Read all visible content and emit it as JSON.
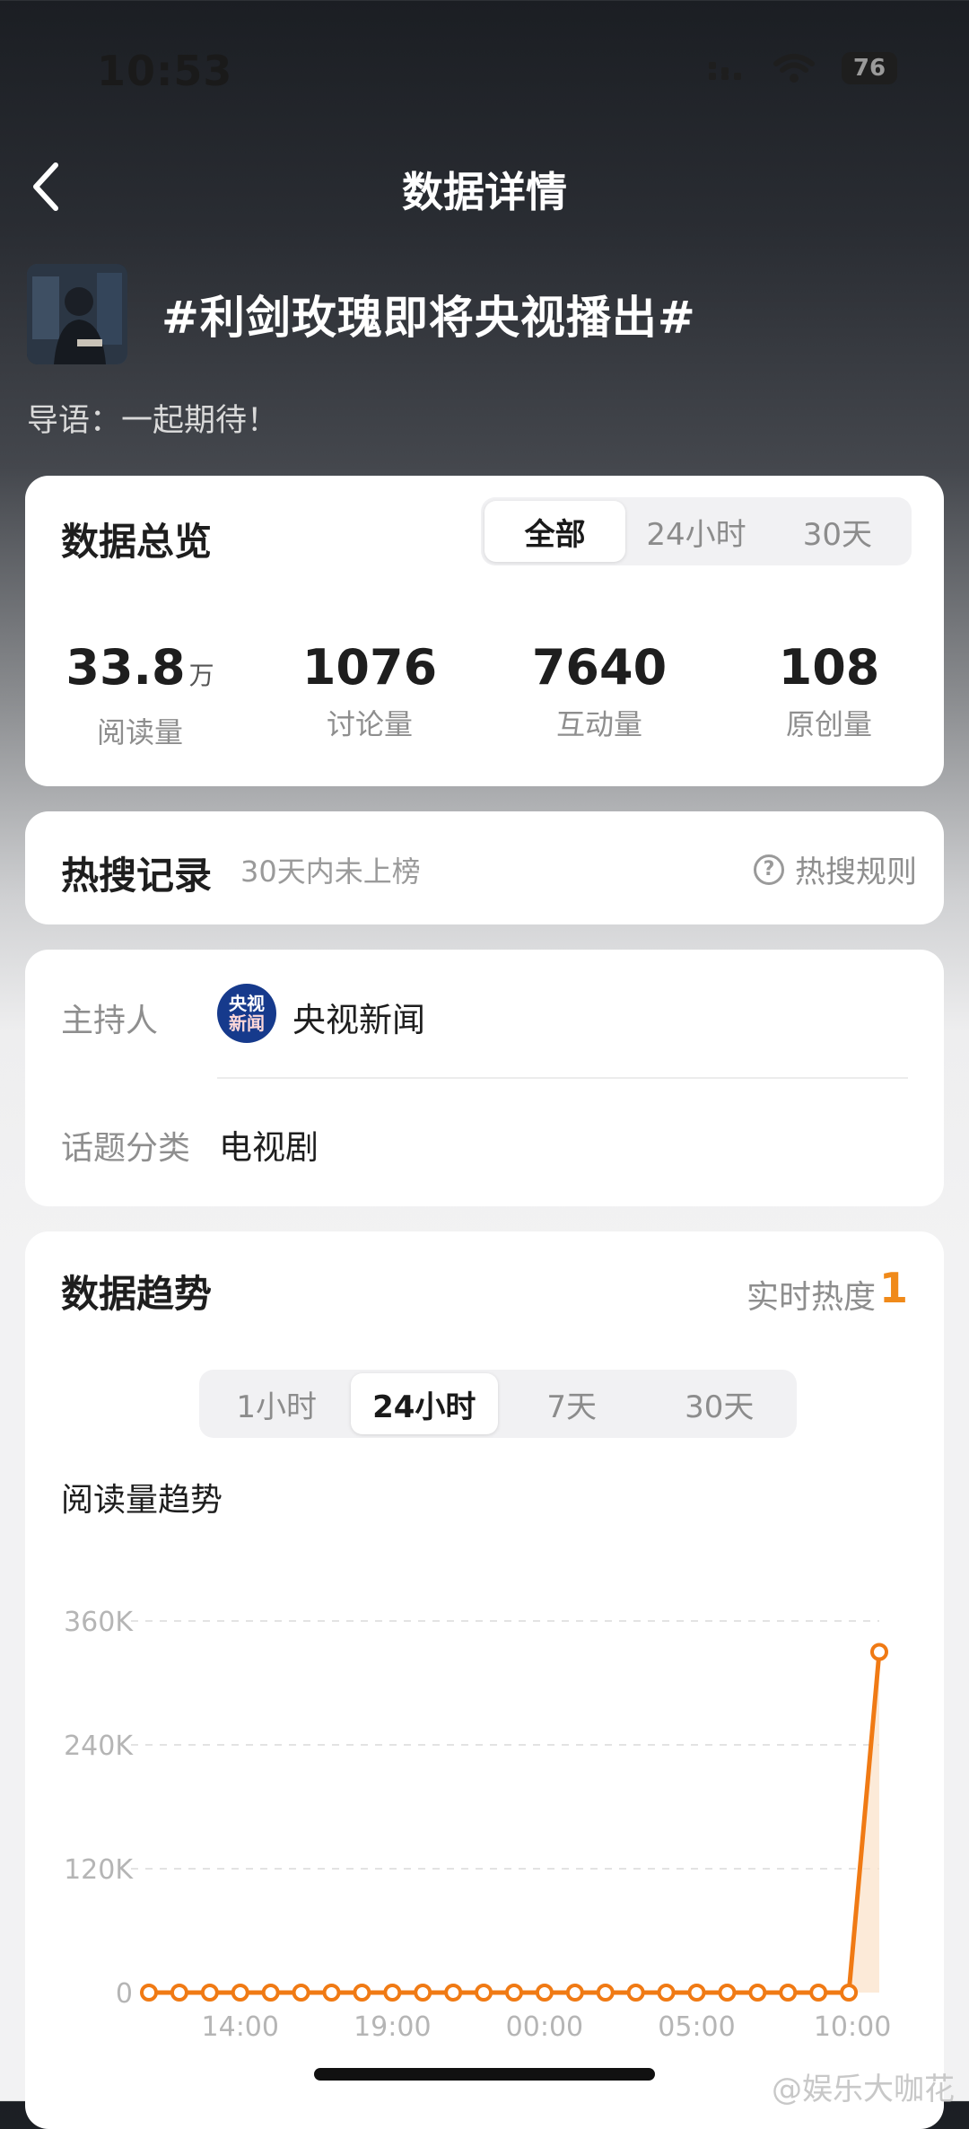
{
  "status_bar": {
    "time": "10:53",
    "battery": "76"
  },
  "header": {
    "title": "数据详情"
  },
  "topic": {
    "title": "#利剑玫瑰即将央视播出#",
    "intro": "导语：一起期待！"
  },
  "overview": {
    "title": "数据总览",
    "tabs": [
      "全部",
      "24小时",
      "30天"
    ],
    "active_tab": "全部",
    "stats": [
      {
        "value": "33.8",
        "unit": "万",
        "label": "阅读量"
      },
      {
        "value": "1076",
        "unit": "",
        "label": "讨论量"
      },
      {
        "value": "7640",
        "unit": "",
        "label": "互动量"
      },
      {
        "value": "108",
        "unit": "",
        "label": "原创量"
      }
    ]
  },
  "hot_search": {
    "title": "热搜记录",
    "subtitle": "30天内未上榜",
    "rules": "热搜规则"
  },
  "info": {
    "host_label": "主持人",
    "host_name": "央视新闻",
    "host_logo_top": "央视",
    "host_logo_bottom": "新闻",
    "category_label": "话题分类",
    "category_value": "电视剧"
  },
  "trend": {
    "title": "数据趋势",
    "heat_label": "实时热度",
    "heat_value": "1",
    "tabs": [
      "1小时",
      "24小时",
      "7天",
      "30天"
    ],
    "active_tab": "24小时",
    "chart_title": "阅读量趋势"
  },
  "chart_data": {
    "type": "line",
    "title": "阅读量趋势",
    "x_ticks": [
      "14:00",
      "19:00",
      "00:00",
      "05:00",
      "10:00"
    ],
    "y_ticks": [
      "360K",
      "240K",
      "120K",
      "0"
    ],
    "ylim": [
      0,
      360000
    ],
    "grid": true,
    "line_color": "#f07a14",
    "series": [
      {
        "values": [
          0,
          0,
          0,
          0,
          0,
          0,
          0,
          0,
          0,
          0,
          0,
          0,
          0,
          0,
          0,
          0,
          0,
          0,
          0,
          0,
          0,
          0,
          0,
          0,
          330000
        ]
      }
    ]
  },
  "watermark": "@娱乐大咖花"
}
